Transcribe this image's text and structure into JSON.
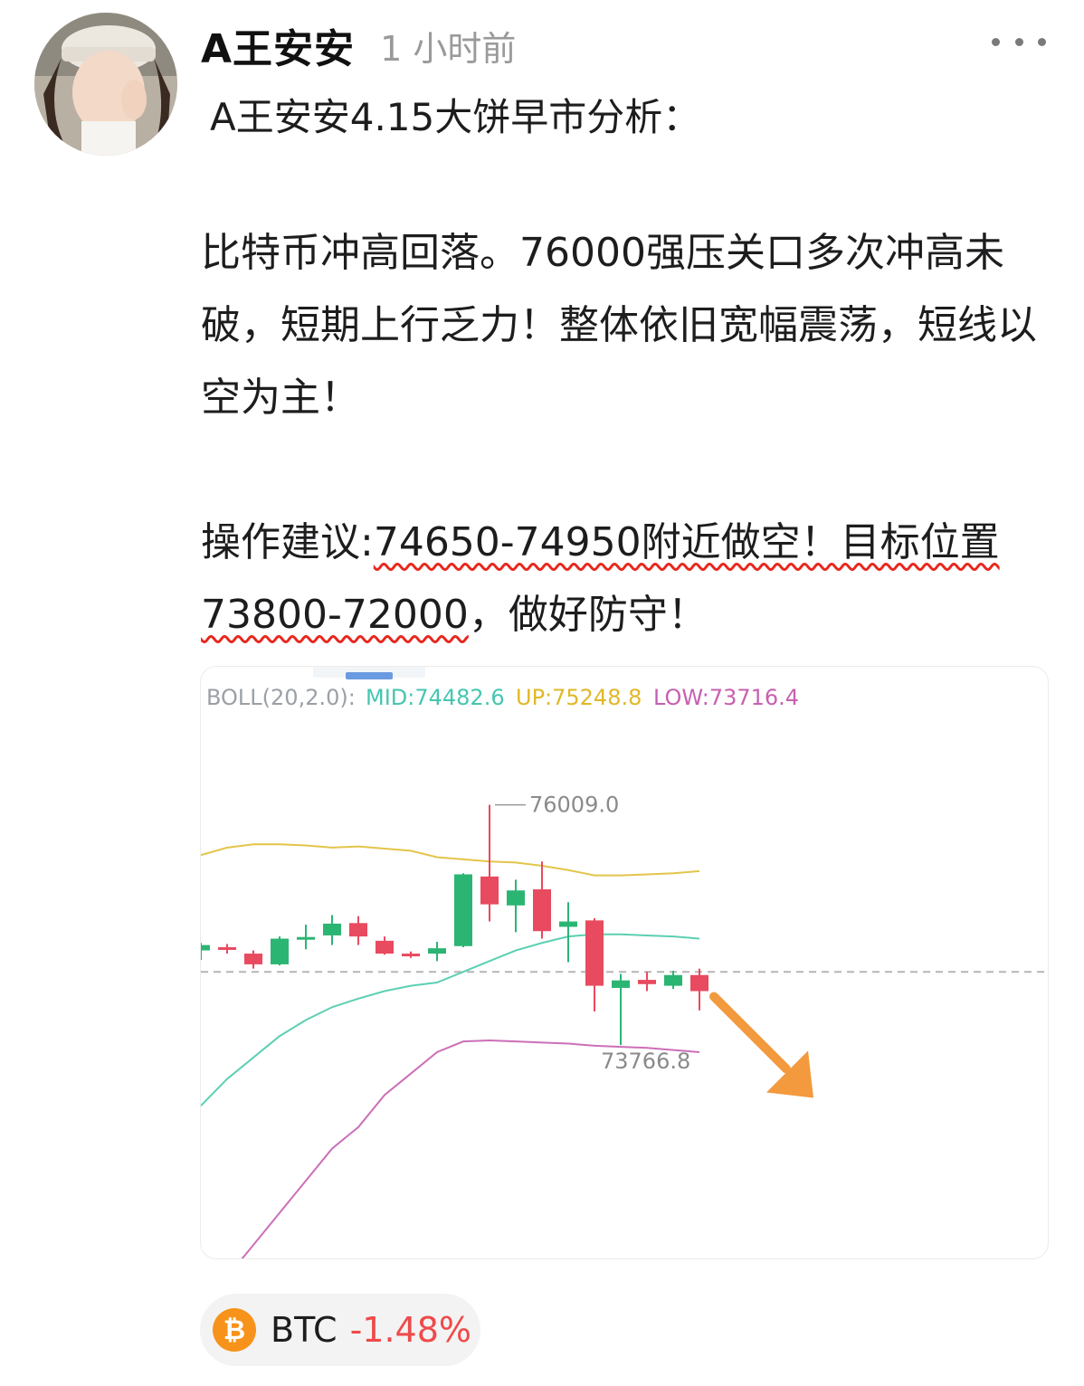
{
  "author": {
    "name": "A王安安",
    "time": "1 小时前",
    "avatar": "user-avatar-photo"
  },
  "post": {
    "title": "A王安安4.15大饼早市分析：",
    "para1": "比特币冲高回落。76000强压关口多次冲高未破，短期上行乏力！整体依旧宽幅震荡，短线以空为主！",
    "para2_prefix": "操作建议:",
    "para2_highlight": "74650-74950附近做空！目标位置73800-72000",
    "para2_suffix": "，做好防守！"
  },
  "chart_data": {
    "type": "candlestick",
    "indicator": {
      "label": "BOLL(20,2.0):",
      "mid_label": "MID:74482.6",
      "up_label": "UP:75248.8",
      "low_label": "LOW:73716.4"
    },
    "colors": {
      "up": "#2bb573",
      "down": "#e84a5f",
      "mid": "#5ccfb3",
      "upper": "#e3c54a",
      "lower": "#cc6fb8",
      "arrow": "#f39a3e"
    },
    "y_range": [
      72800,
      76200
    ],
    "last_price": 74450,
    "max_annotation": "76009.0",
    "min_annotation": "73766.8",
    "candles": [
      {
        "o": 74650,
        "h": 74720,
        "l": 74560,
        "c": 74700
      },
      {
        "o": 74680,
        "h": 74710,
        "l": 74620,
        "c": 74660
      },
      {
        "o": 74620,
        "h": 74650,
        "l": 74480,
        "c": 74520
      },
      {
        "o": 74520,
        "h": 74780,
        "l": 74510,
        "c": 74760
      },
      {
        "o": 74765,
        "h": 74890,
        "l": 74660,
        "c": 74775
      },
      {
        "o": 74790,
        "h": 74980,
        "l": 74700,
        "c": 74900
      },
      {
        "o": 74905,
        "h": 74970,
        "l": 74700,
        "c": 74780
      },
      {
        "o": 74740,
        "h": 74780,
        "l": 74610,
        "c": 74620
      },
      {
        "o": 74620,
        "h": 74640,
        "l": 74580,
        "c": 74610
      },
      {
        "o": 74620,
        "h": 74730,
        "l": 74550,
        "c": 74670
      },
      {
        "o": 74690,
        "h": 75370,
        "l": 74680,
        "c": 75360
      },
      {
        "o": 75340,
        "h": 76009,
        "l": 74920,
        "c": 75080
      },
      {
        "o": 75070,
        "h": 75310,
        "l": 74820,
        "c": 75210
      },
      {
        "o": 75220,
        "h": 75480,
        "l": 74760,
        "c": 74830
      },
      {
        "o": 74870,
        "h": 75100,
        "l": 74540,
        "c": 74920
      },
      {
        "o": 74930,
        "h": 74950,
        "l": 74080,
        "c": 74320
      },
      {
        "o": 74300,
        "h": 74430,
        "l": 73766.8,
        "c": 74370
      },
      {
        "o": 74375,
        "h": 74450,
        "l": 74270,
        "c": 74335
      },
      {
        "o": 74320,
        "h": 74460,
        "l": 74290,
        "c": 74420
      },
      {
        "o": 74420,
        "h": 74480,
        "l": 74090,
        "c": 74270
      }
    ],
    "upper_band": [
      75540,
      75610,
      75640,
      75640,
      75630,
      75610,
      75620,
      75600,
      75580,
      75520,
      75500,
      75480,
      75470,
      75440,
      75400,
      75350,
      75350,
      75360,
      75370,
      75390
    ],
    "middle_band": [
      73200,
      73450,
      73650,
      73850,
      74000,
      74120,
      74200,
      74270,
      74320,
      74350,
      74450,
      74550,
      74650,
      74720,
      74780,
      74800,
      74800,
      74790,
      74780,
      74760
    ],
    "lower_band": [
      71400,
      71600,
      71900,
      72200,
      72500,
      72800,
      73000,
      73300,
      73500,
      73700,
      73800,
      73810,
      73800,
      73790,
      73780,
      73760,
      73750,
      73740,
      73720,
      73700
    ]
  },
  "coin": {
    "symbol": "BTC",
    "change": "-1.48%",
    "icon": "bitcoin-icon"
  }
}
